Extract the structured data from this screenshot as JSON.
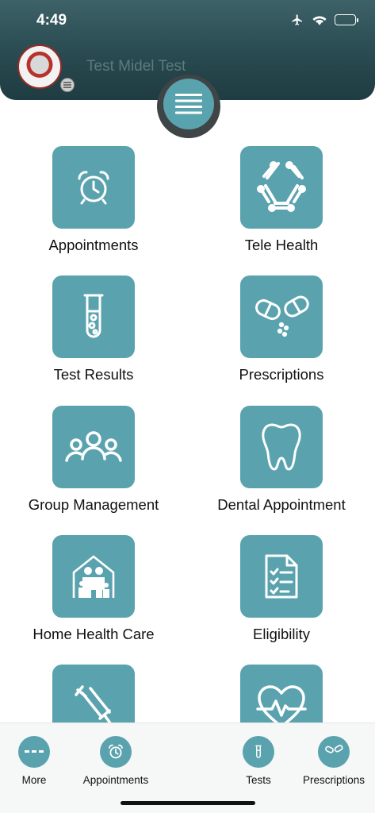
{
  "status_bar": {
    "time": "4:49"
  },
  "header": {
    "user_name": "Test Midel Test"
  },
  "grid": {
    "items": [
      {
        "label": "Appointments",
        "icon": "alarm-clock-icon"
      },
      {
        "label": "Tele Health",
        "icon": "circuit-ring-icon"
      },
      {
        "label": "Test Results",
        "icon": "test-tube-icon"
      },
      {
        "label": "Prescriptions",
        "icon": "pills-icon"
      },
      {
        "label": "Group Management",
        "icon": "group-icon"
      },
      {
        "label": "Dental Appointment",
        "icon": "tooth-icon"
      },
      {
        "label": "Home Health Care",
        "icon": "family-home-icon"
      },
      {
        "label": "Eligibility",
        "icon": "checklist-document-icon"
      },
      {
        "label": "",
        "icon": "syringe-icon"
      },
      {
        "label": "",
        "icon": "heart-pulse-icon"
      }
    ]
  },
  "tabbar": {
    "items": [
      {
        "label": "More",
        "icon": "more-dashes-icon"
      },
      {
        "label": "Appointments",
        "icon": "alarm-clock-icon"
      },
      {
        "label": "Tests",
        "icon": "test-tube-icon"
      },
      {
        "label": "Prescriptions",
        "icon": "pills-icon"
      }
    ]
  },
  "colors": {
    "accent": "#5aa3ae",
    "header": "#284a50",
    "tabbar": "#f6f7f7"
  }
}
